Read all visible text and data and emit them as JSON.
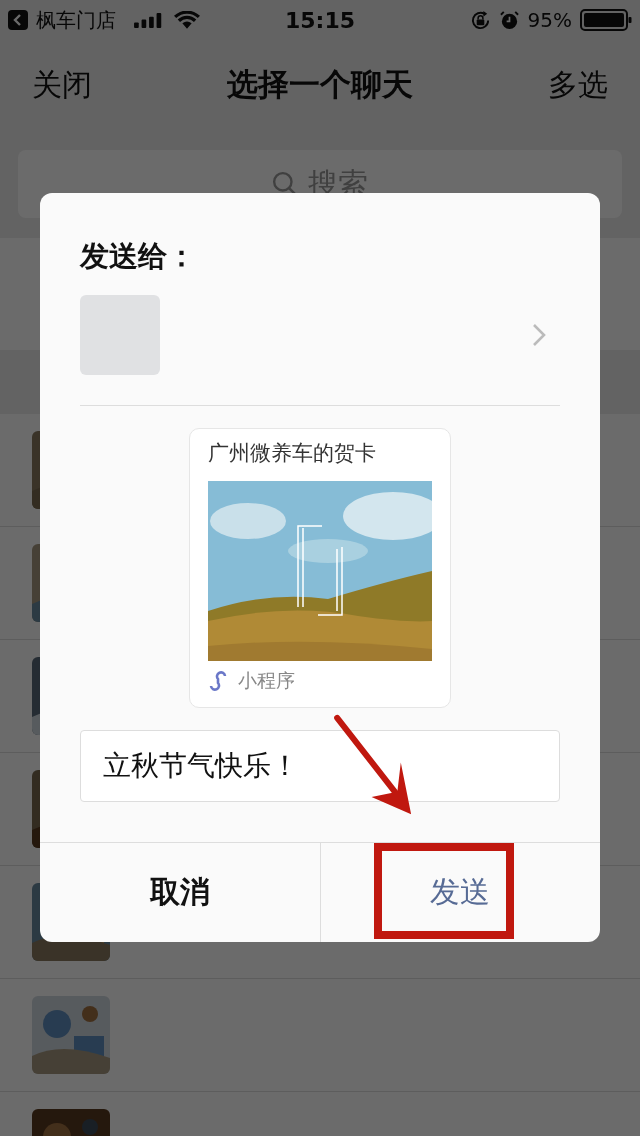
{
  "status_bar": {
    "back_app": "枫车门店",
    "time": "15:15",
    "battery": "95%"
  },
  "nav": {
    "left": "关闭",
    "title": "选择一个聊天",
    "right": "多选"
  },
  "search": {
    "placeholder": "搜索"
  },
  "dialog": {
    "heading": "发送给：",
    "card": {
      "title": "广州微养车的贺卡",
      "source": "小程序"
    },
    "message": {
      "value": "立秋节气快乐！"
    },
    "buttons": [
      {
        "label": "取消",
        "kind": "cancel",
        "highlighted": false
      },
      {
        "label": "发送",
        "kind": "confirm",
        "highlighted": true
      }
    ]
  }
}
